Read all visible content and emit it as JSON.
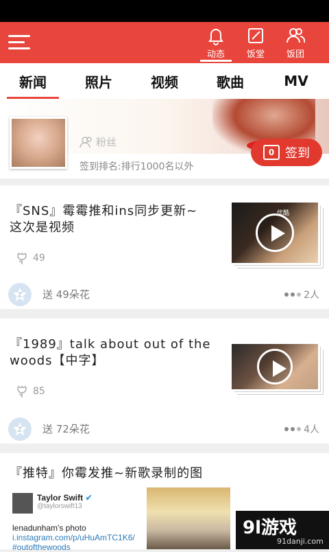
{
  "topbar": {
    "nav": [
      {
        "label": "动态",
        "icon": "bell-icon"
      },
      {
        "label": "饭堂",
        "icon": "edit-icon"
      },
      {
        "label": "饭团",
        "icon": "group-icon"
      }
    ]
  },
  "tabs": [
    "新闻",
    "照片",
    "视频",
    "歌曲",
    "MV"
  ],
  "profile": {
    "fans_label": "粉丝",
    "rank_text": "签到排名:排行1000名以外",
    "checkin_label": "签到",
    "checkin_day": "0"
  },
  "feed": [
    {
      "title": "『SNS』霉霉推和ins同步更新~这次是视频",
      "likes": "49",
      "send_text": "送 49朵花",
      "people": "2人",
      "thumb_caption": "优酷"
    },
    {
      "title": "『1989』talk about out of the woods【中字】",
      "likes": "85",
      "send_text": "送 72朵花",
      "people": "4人"
    },
    {
      "title": "『推特』你霉发推~新歌录制的图"
    }
  ],
  "tweet": {
    "name": "Taylor Swift",
    "handle": "@taylorswift13",
    "text": "lenadunham's photo",
    "link": "i.instagram.com/p/uHuAmTC1K6/",
    "hashtag": "#outofthewoods"
  },
  "watermark": {
    "logo": "9l游戏",
    "url": "91danji.com"
  },
  "colors": {
    "accent": "#e8453c",
    "checkin": "#e2392f"
  }
}
